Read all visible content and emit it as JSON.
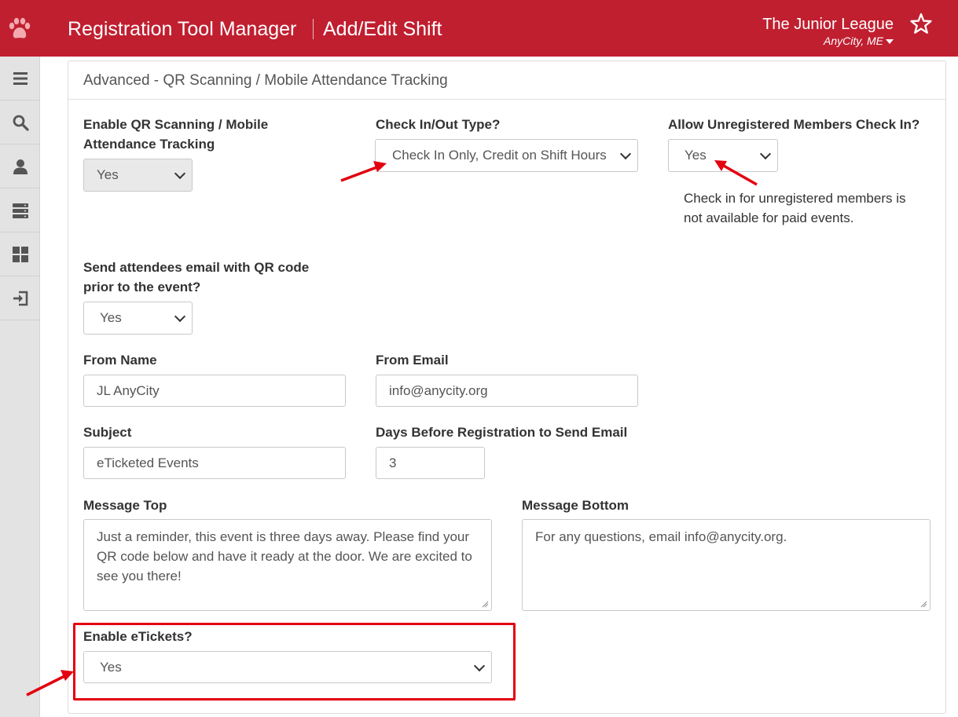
{
  "header": {
    "app_title": "Registration Tool Manager",
    "page_title": "Add/Edit Shift",
    "org_name": "The Junior League",
    "org_location": "AnyCity, ME",
    "brand_color": "#c01f30",
    "logo_icon": "paw-icon",
    "favorite_icon": "star-icon"
  },
  "sidebar": {
    "items": [
      {
        "icon": "menu-icon"
      },
      {
        "icon": "search-icon"
      },
      {
        "icon": "user-icon"
      },
      {
        "icon": "server-icon"
      },
      {
        "icon": "dashboard-icon"
      },
      {
        "icon": "logout-icon"
      }
    ]
  },
  "panel": {
    "heading": "Advanced - QR Scanning / Mobile Attendance Tracking"
  },
  "form": {
    "enable_qr": {
      "label": "Enable QR Scanning / Mobile Attendance Tracking",
      "value": "Yes"
    },
    "check_type": {
      "label": "Check In/Out Type?",
      "value": "Check In Only, Credit on Shift Hours"
    },
    "allow_unregistered": {
      "label": "Allow Unregistered Members Check In?",
      "value": "Yes",
      "help": "Check in for unregistered members is not available for paid events."
    },
    "send_email": {
      "label": "Send attendees email with QR code prior to the event?",
      "value": "Yes"
    },
    "from_name": {
      "label": "From Name",
      "value": "JL AnyCity"
    },
    "from_email": {
      "label": "From Email",
      "value": "info@anycity.org"
    },
    "subject": {
      "label": "Subject",
      "value": "eTicketed Events"
    },
    "days_before": {
      "label": "Days Before Registration to Send Email",
      "value": "3"
    },
    "message_top": {
      "label": "Message Top",
      "value": "Just a reminder, this event is three days away. Please find your QR code below and have it ready at the door. We are excited to see you there!"
    },
    "message_bottom": {
      "label": "Message Bottom",
      "value": "For any questions, email info@anycity.org."
    },
    "enable_etickets": {
      "label": "Enable eTickets?",
      "value": "Yes"
    }
  },
  "annotation_color": "#e3000f"
}
